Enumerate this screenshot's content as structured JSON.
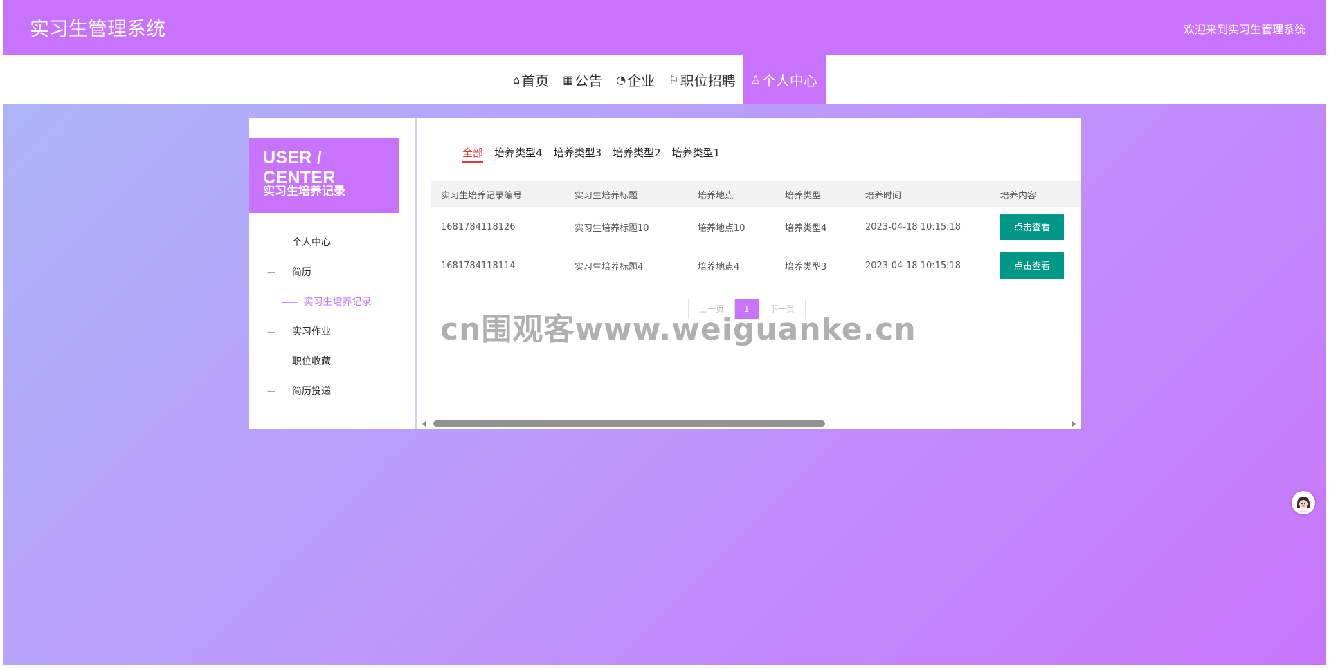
{
  "header": {
    "brand": "实习生管理系统",
    "welcome": "欢迎来到实习生管理系统"
  },
  "nav": {
    "items": [
      {
        "icon": "home-icon",
        "glyph": "⌂",
        "label": "首页"
      },
      {
        "icon": "notice-icon",
        "glyph": "▦",
        "label": "公告"
      },
      {
        "icon": "dashboard-icon",
        "glyph": "◔",
        "label": "企业"
      },
      {
        "icon": "flag-icon",
        "glyph": "⚐",
        "label": "职位招聘"
      },
      {
        "icon": "user-icon",
        "glyph": "♙",
        "label": "个人中心"
      }
    ]
  },
  "sidebar": {
    "title_en": "USER / CENTER",
    "title_cn": "实习生培养记录",
    "items": [
      {
        "label": "个人中心"
      },
      {
        "label": "简历"
      },
      {
        "label": "实习生培养记录"
      },
      {
        "label": "实习作业"
      },
      {
        "label": "职位收藏"
      },
      {
        "label": "简历投递"
      }
    ]
  },
  "tabs": [
    "全部",
    "培养类型4",
    "培养类型3",
    "培养类型2",
    "培养类型1"
  ],
  "table": {
    "headers": [
      "实习生培养记录编号",
      "实习生培养标题",
      "培养地点",
      "培养类型",
      "培养时间",
      "培养内容"
    ],
    "rows": [
      [
        "1681784118126",
        "实习生培养标题10",
        "培养地点10",
        "培养类型4",
        "2023-04-18 10:15:18",
        "点击查看"
      ],
      [
        "1681784118114",
        "实习生培养标题4",
        "培养地点4",
        "培养类型3",
        "2023-04-18 10:15:18",
        "点击查看"
      ]
    ]
  },
  "pager": {
    "prev": "上一页",
    "current": "1",
    "next": "下一页"
  },
  "watermark": "cn围观客www.weiguanke.cn",
  "colors": {
    "accent": "#c873fd",
    "button": "#009688",
    "tab_active": "#e23a3a"
  }
}
